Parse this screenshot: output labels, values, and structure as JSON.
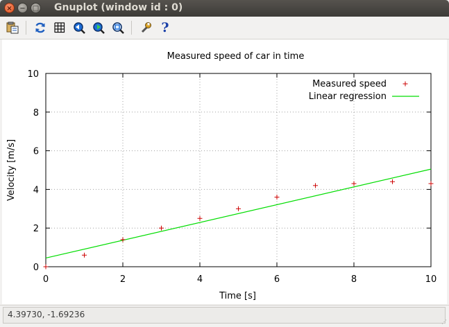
{
  "window": {
    "title": "Gnuplot (window id : 0)",
    "close_glyph": "×",
    "minimize_glyph": "−",
    "maximize_glyph": "□"
  },
  "toolbar": {
    "buttons": [
      {
        "name": "copy-to-clipboard-button",
        "icon": "clipboard-icon"
      },
      {
        "name": "replot-button",
        "icon": "refresh-icon"
      },
      {
        "name": "toggle-grid-button",
        "icon": "grid-icon"
      },
      {
        "name": "previous-zoom-button",
        "icon": "zoom-previous-icon"
      },
      {
        "name": "next-zoom-button",
        "icon": "zoom-next-icon"
      },
      {
        "name": "autoscale-button",
        "icon": "zoom-fit-icon"
      },
      {
        "name": "preferences-button",
        "icon": "wrench-icon"
      },
      {
        "name": "help-button",
        "icon": "help-icon",
        "glyph": "?"
      }
    ]
  },
  "colors": {
    "points": "#cc0000",
    "line": "#00dd00",
    "grid": "#a0a0a0",
    "axes": "#000000"
  },
  "chart_data": {
    "type": "scatter",
    "title": "Measured speed of car in time",
    "xlabel": "Time [s]",
    "ylabel": "Velocity [m/s]",
    "xlim": [
      0,
      10
    ],
    "ylim": [
      0,
      10
    ],
    "xticks": [
      0,
      2,
      4,
      6,
      8,
      10
    ],
    "yticks": [
      0,
      2,
      4,
      6,
      8,
      10
    ],
    "grid": true,
    "legend_position": "top-right",
    "series": [
      {
        "name": "Measured speed",
        "style": "points",
        "marker": "+",
        "x": [
          0,
          1,
          2,
          3,
          4,
          5,
          6,
          7,
          8,
          9,
          10
        ],
        "y": [
          0,
          0.6,
          1.4,
          2.0,
          2.5,
          3.0,
          3.6,
          4.2,
          4.3,
          4.4,
          4.3
        ]
      },
      {
        "name": "Linear regression",
        "style": "line",
        "x": [
          0,
          10
        ],
        "y": [
          0.45,
          5.05
        ]
      }
    ]
  },
  "status": {
    "coordinates": "4.39730, -1.69236"
  }
}
